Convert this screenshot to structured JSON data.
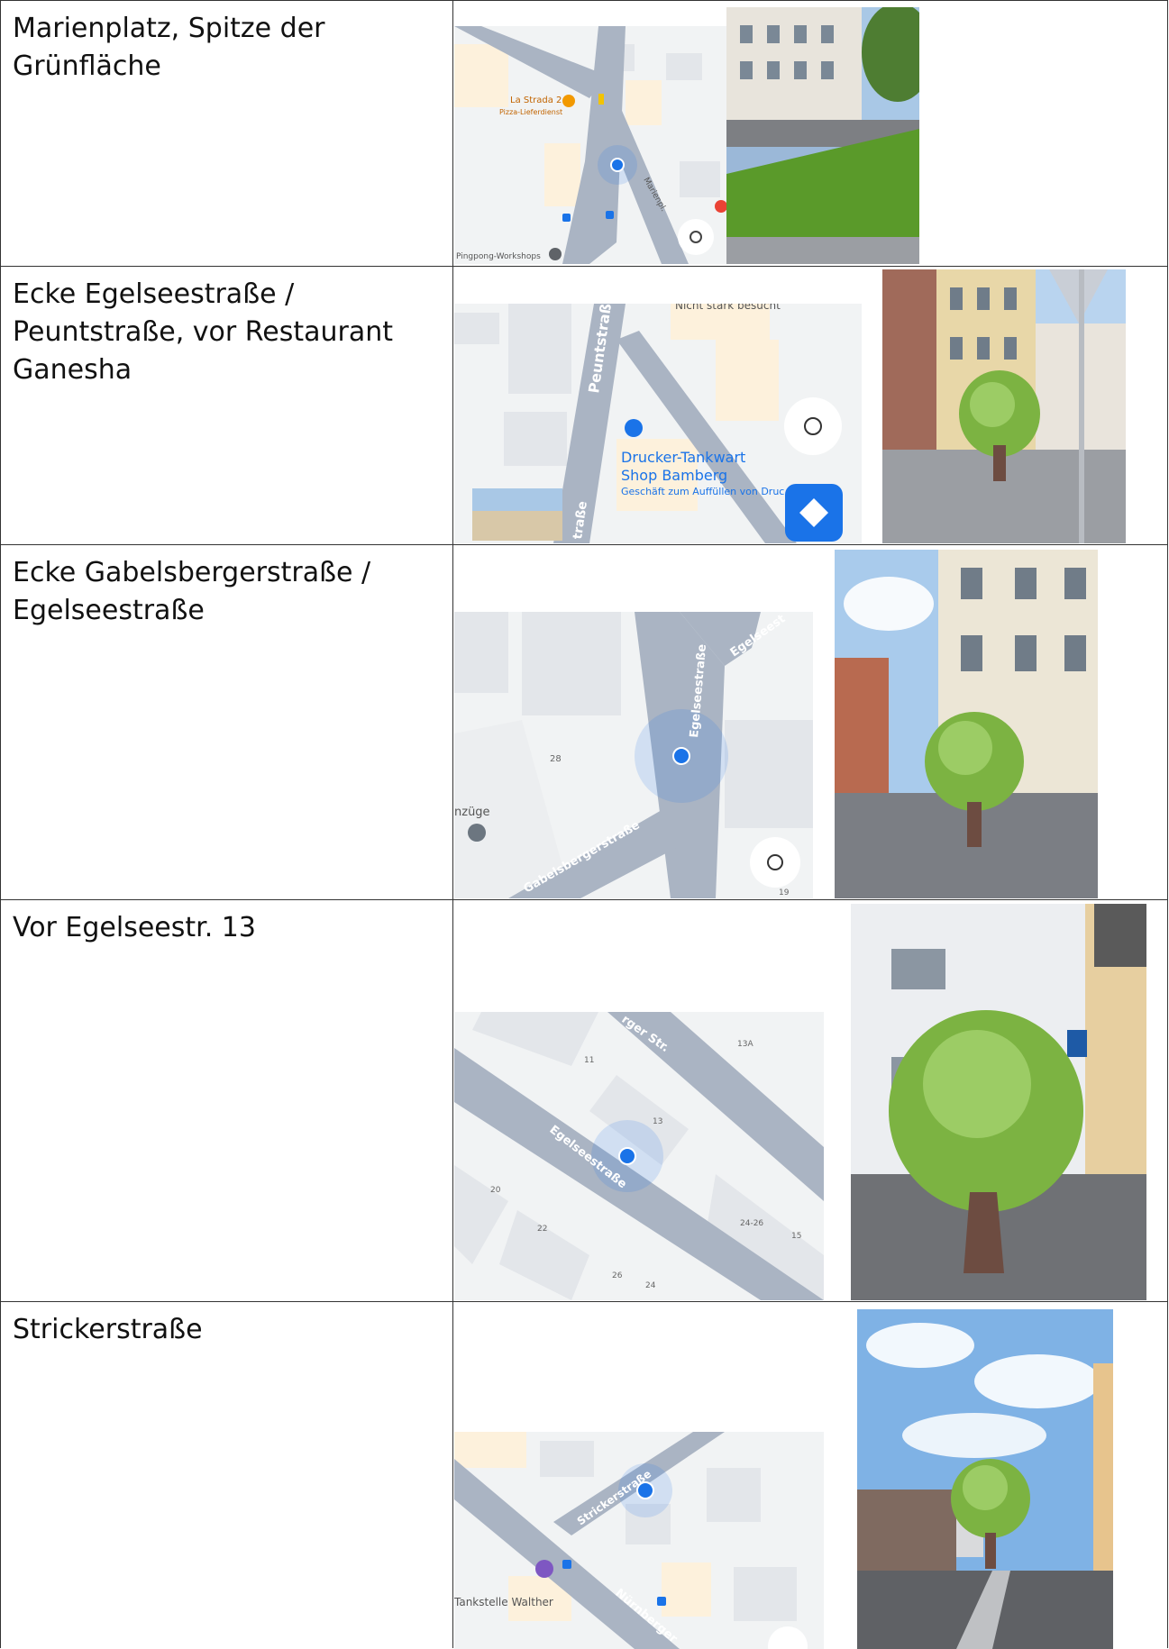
{
  "rows": [
    {
      "label": "Marienplatz, Spitze der Grünfläche",
      "map": {
        "labels": [
          "La Strada 2",
          "Pizza-Lieferdienst",
          "Marienpl.",
          "Pingpong-Workshops"
        ]
      }
    },
    {
      "label": "Ecke Egelseestraße / Peuntstraße, vor Restaurant Ganesha",
      "map": {
        "labels": [
          "Nicht stark besucht",
          "Peuntstraße",
          "Drucker-Tankwart",
          "Shop Bamberg",
          "Geschäft zum Auffüllen von Druc",
          "traße"
        ]
      }
    },
    {
      "label": "Ecke Gabelsbergerstraße / Egelseestraße",
      "map": {
        "labels": [
          "Egelseestraße",
          "Egelseest",
          "Gabelsbergerstraße",
          "28",
          "nzüge",
          "19"
        ]
      }
    },
    {
      "label": "Vor Egelseestr. 13",
      "map": {
        "labels": [
          "rger Str.",
          "13A",
          "11",
          "13",
          "Egelseestraße",
          "20",
          "22",
          "24-26",
          "15",
          "26",
          "24"
        ]
      }
    },
    {
      "label": "Strickerstraße",
      "map": {
        "labels": [
          "Strickerstraße",
          "Tankstelle Walther",
          "Nürnberger"
        ]
      }
    }
  ],
  "colors": {
    "map_bg": "#f1f3f4",
    "road": "#aab4c3",
    "block": "#e3e6ea",
    "location_dot": "#1a73e8",
    "tree_green": "#7cb342",
    "trunk": "#6d4c41"
  },
  "icons": [
    "restaurant-pin-icon",
    "traffic-light-icon",
    "bus-stop-icon",
    "my-location-icon",
    "directions-icon",
    "shopping-pin-icon",
    "gas-station-pin-icon",
    "tree-overlay-icon",
    "parking-sign-icon"
  ]
}
